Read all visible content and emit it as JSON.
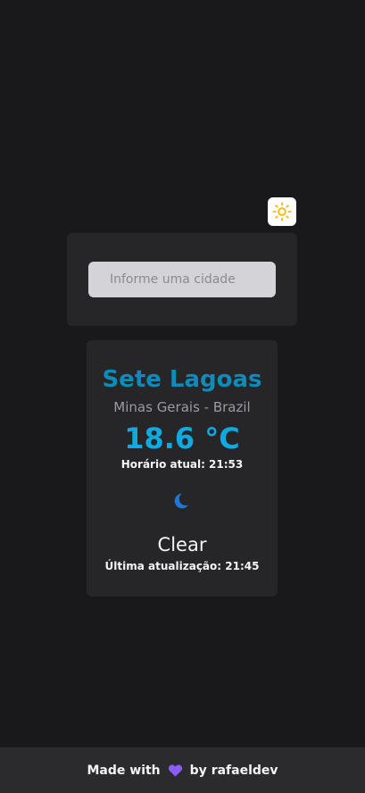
{
  "theme_toggle": {
    "icon": "sun-icon",
    "icon_color": "#f5b800"
  },
  "search": {
    "placeholder": "Informe uma cidade",
    "value": ""
  },
  "weather": {
    "city": "Sete Lagoas",
    "region": "Minas Gerais - Brazil",
    "temperature": "18.6 °C",
    "local_time": "Horário atual: 21:53",
    "icon": "moon-icon",
    "condition": "Clear",
    "last_updated": "Última atualização: 21:45"
  },
  "footer": {
    "made_with": "Made with",
    "heart_icon": "heart-icon",
    "heart_color": "#8b5cf6",
    "by": "by",
    "author": "rafaeldev"
  },
  "colors": {
    "background": "#19191b",
    "card": "#262629",
    "city": "#0e8bb8",
    "temperature": "#10a9e0"
  }
}
